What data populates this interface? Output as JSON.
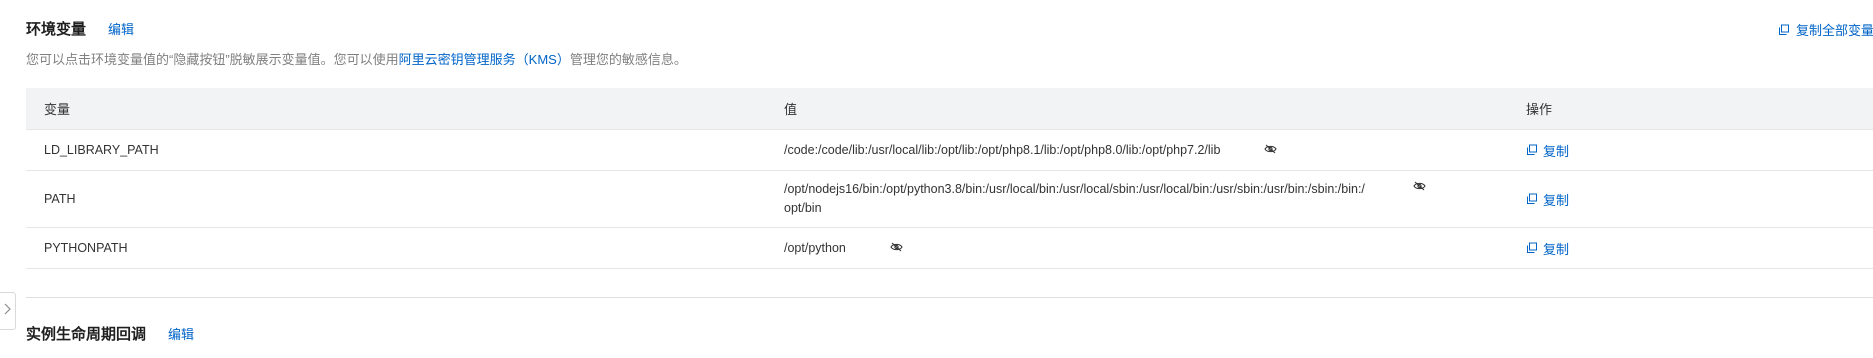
{
  "env_section": {
    "title": "环境变量",
    "edit_label": "编辑",
    "copy_all_label": "复制全部变量",
    "description_before": "您可以点击环境变量值的“隐藏按钮”脱敏展示变量值。您可以使用",
    "description_link": "阿里云密钥管理服务（KMS）",
    "description_after": "管理您的敏感信息。"
  },
  "table": {
    "headers": {
      "variable": "变量",
      "value": "值",
      "action": "操作"
    },
    "rows": [
      {
        "name": "LD_LIBRARY_PATH",
        "value_lines": [
          "/code:/code/lib:/usr/local/lib:/opt/lib:/opt/php8.1/lib:/opt/php8.0/lib:/opt/php7.2/lib"
        ],
        "action_label": "复制"
      },
      {
        "name": "PATH",
        "value_lines": [
          "/opt/nodejs16/bin:/opt/python3.8/bin:/usr/local/bin:/usr/local/sbin:/usr/local/bin:/usr/sbin:/usr/bin:/sbin:/bin:/",
          "opt/bin"
        ],
        "action_label": "复制"
      },
      {
        "name": "PYTHONPATH",
        "value_lines": [
          "/opt/python"
        ],
        "action_label": "复制"
      }
    ]
  },
  "lifecycle_section": {
    "title": "实例生命周期回调",
    "edit_label": "编辑"
  },
  "icons": {
    "copy": "copy-icon",
    "eye_hidden": "eye-off-icon",
    "collapse": "chevron-right-icon"
  },
  "colors": {
    "link": "#0064c8",
    "header_bg": "#f2f3f5",
    "muted_text": "#808080"
  }
}
